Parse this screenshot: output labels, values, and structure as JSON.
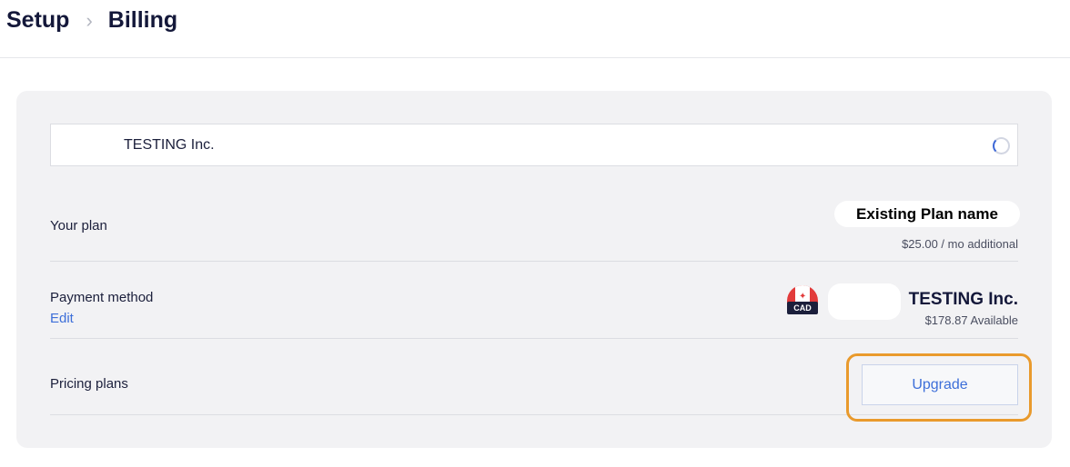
{
  "breadcrumb": {
    "parent": "Setup",
    "separator": "›",
    "current": "Billing"
  },
  "account_select": {
    "value": "TESTING Inc."
  },
  "plan": {
    "label": "Your plan",
    "name": "Existing Plan name",
    "price": "$25.00 / mo additional"
  },
  "payment": {
    "label": "Payment method",
    "edit_label": "Edit",
    "currency_badge": "CAD",
    "flag_glyph": "✦",
    "account_name": "TESTING Inc.",
    "available": "$178.87 Available"
  },
  "pricing": {
    "label": "Pricing plans",
    "upgrade_label": "Upgrade"
  },
  "icons": {
    "spinner": "loading-spinner-icon",
    "flag": "canada-flag-icon",
    "chevron": "chevron-right-icon"
  },
  "colors": {
    "accent": "#3d6fd9",
    "highlight": "#e99a2c",
    "card_bg": "#f2f2f4",
    "flag_red": "#e23b3b"
  }
}
